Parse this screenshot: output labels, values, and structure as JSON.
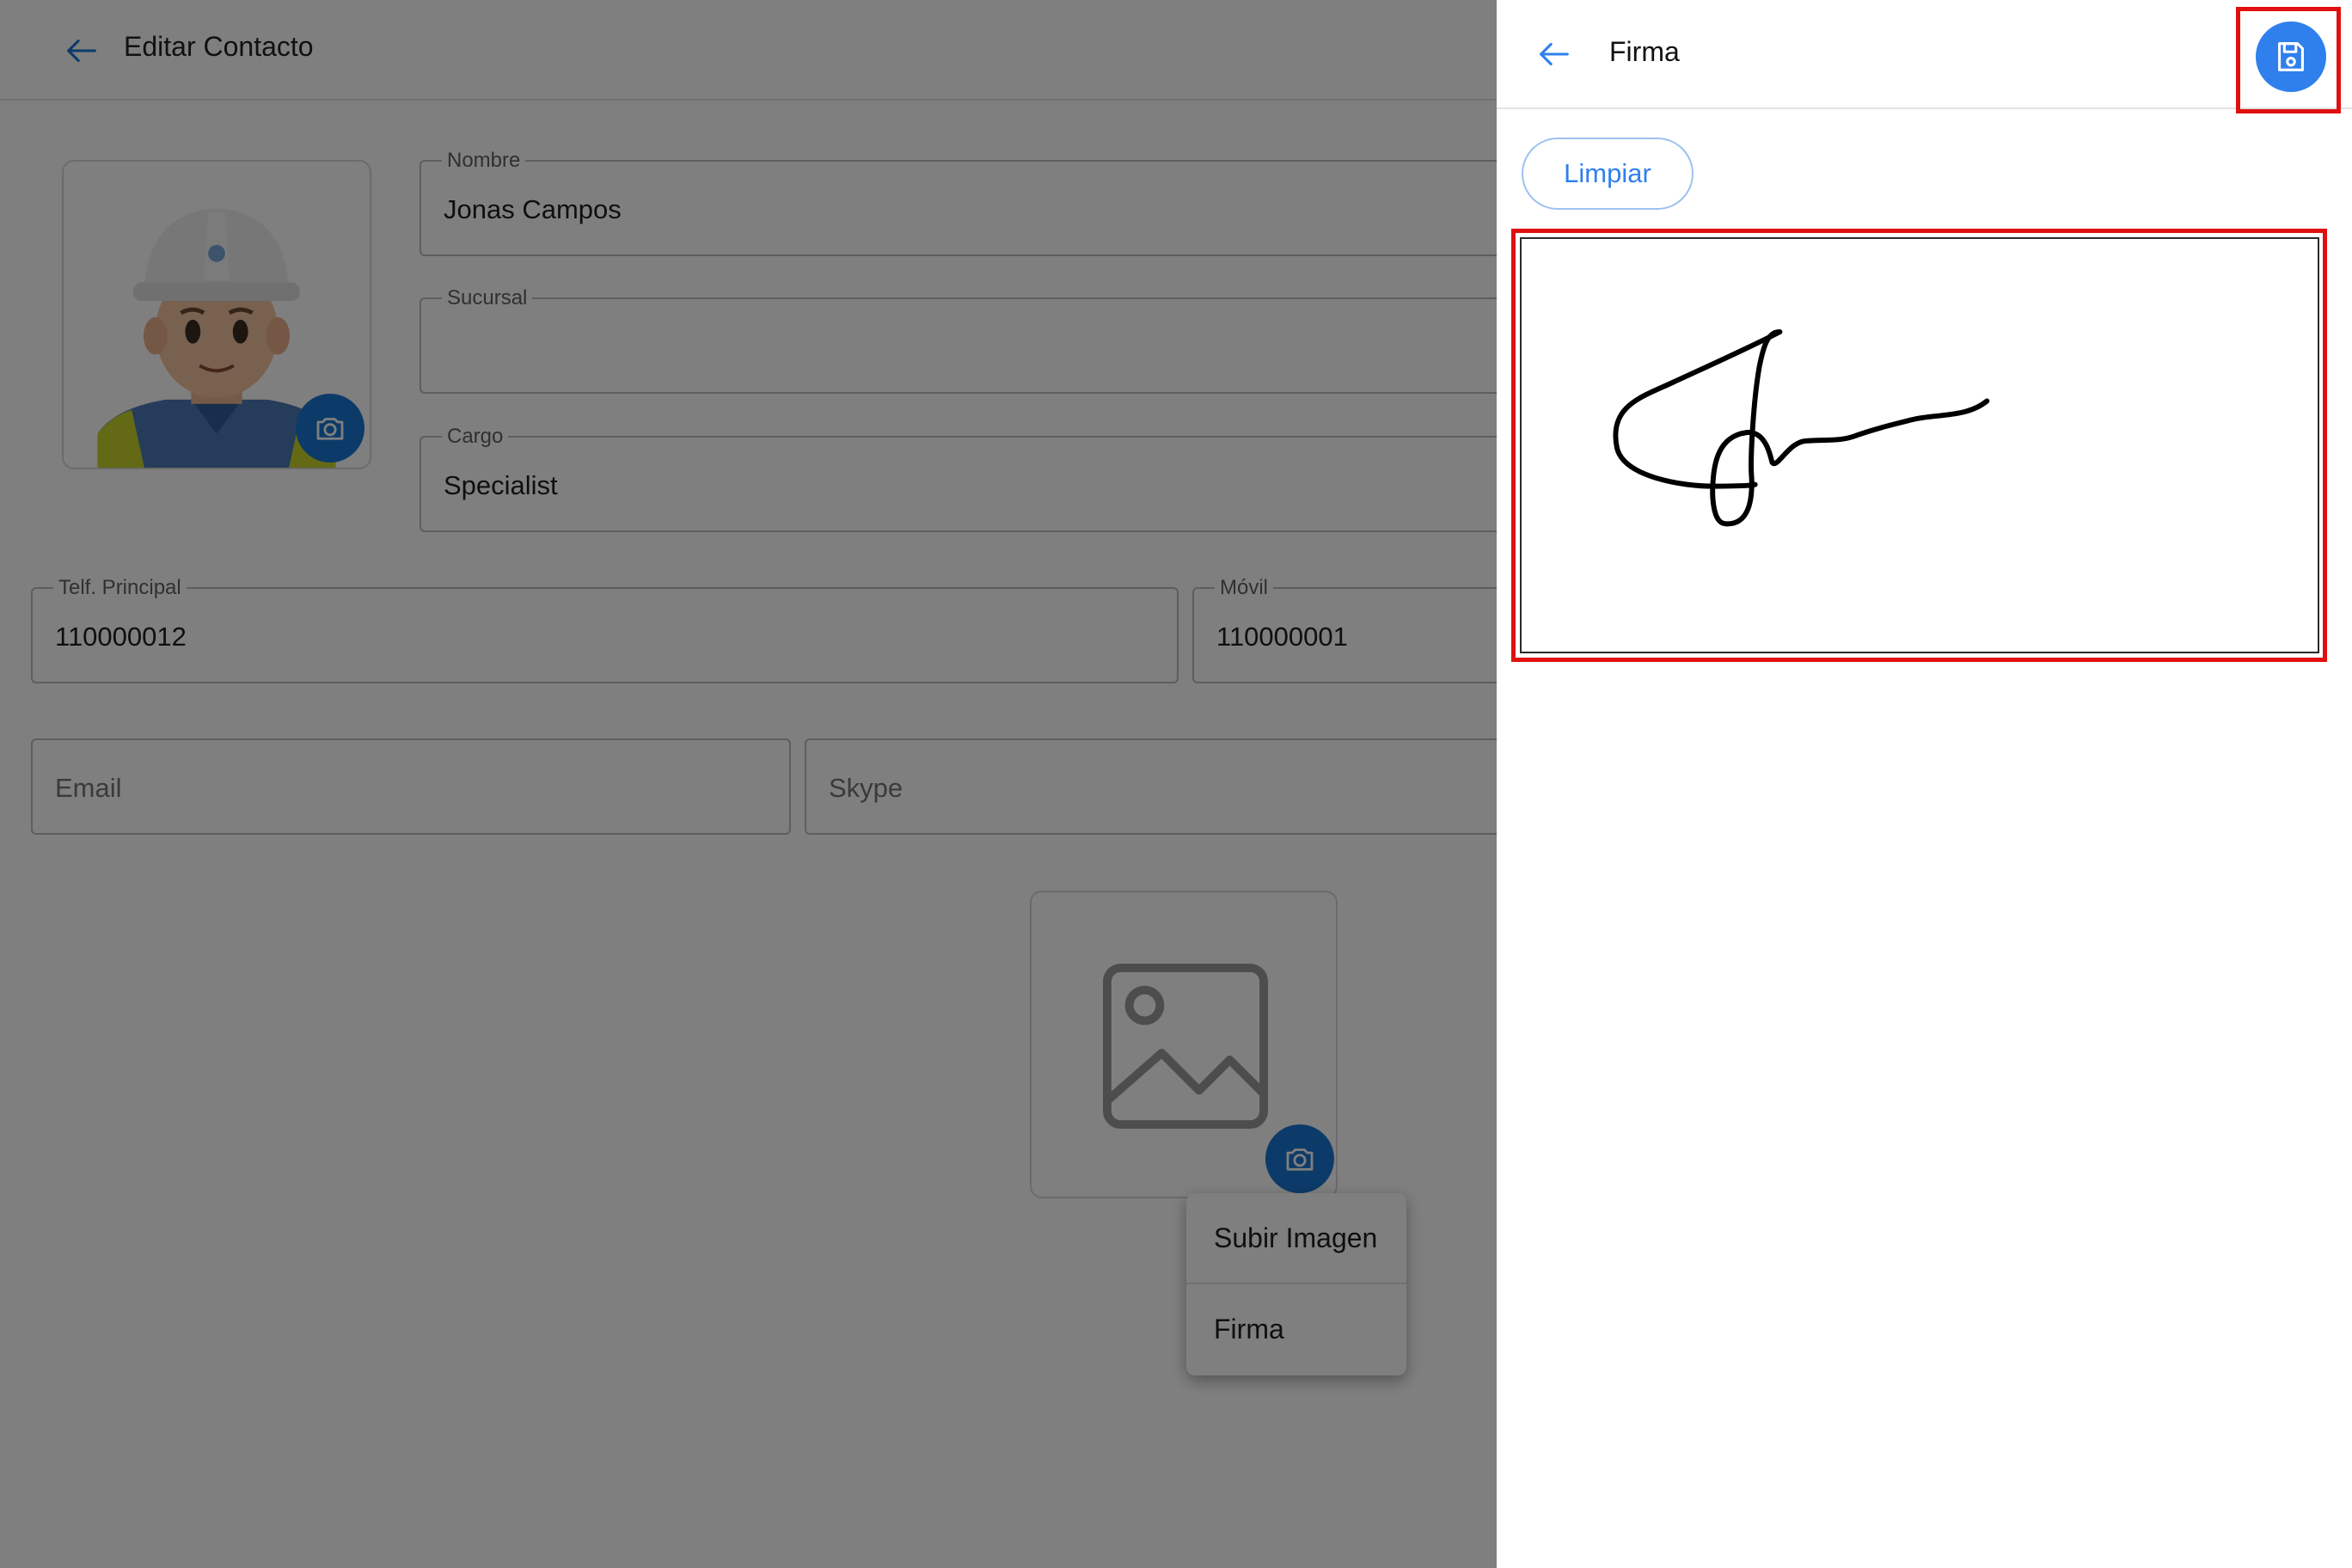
{
  "form": {
    "title": "Editar Contacto",
    "fields": {
      "nombre": {
        "label": "Nombre",
        "value": "Jonas Campos"
      },
      "sucursal": {
        "label": "Sucursal",
        "value": ""
      },
      "cargo": {
        "label": "Cargo",
        "value": "Specialist"
      },
      "telefono": {
        "label": "Telf. Principal",
        "value": "110000012"
      },
      "movil": {
        "label": "Móvil",
        "value": "110000001"
      },
      "email": {
        "placeholder": "Email"
      },
      "skype": {
        "placeholder": "Skype"
      }
    },
    "image_menu": {
      "items": [
        "Subir Imagen",
        "Firma"
      ]
    }
  },
  "signature_panel": {
    "title": "Firma",
    "clear_label": "Limpiar"
  },
  "colors": {
    "accent": "#2f80ed",
    "fab": "#1976d2",
    "highlight": "#e01010",
    "scrim": "rgba(0,0,0,0.5)"
  },
  "icons": {
    "back": "arrow-left-icon",
    "save": "floppy-disk-icon",
    "camera": "camera-icon",
    "image_placeholder": "image-icon"
  }
}
